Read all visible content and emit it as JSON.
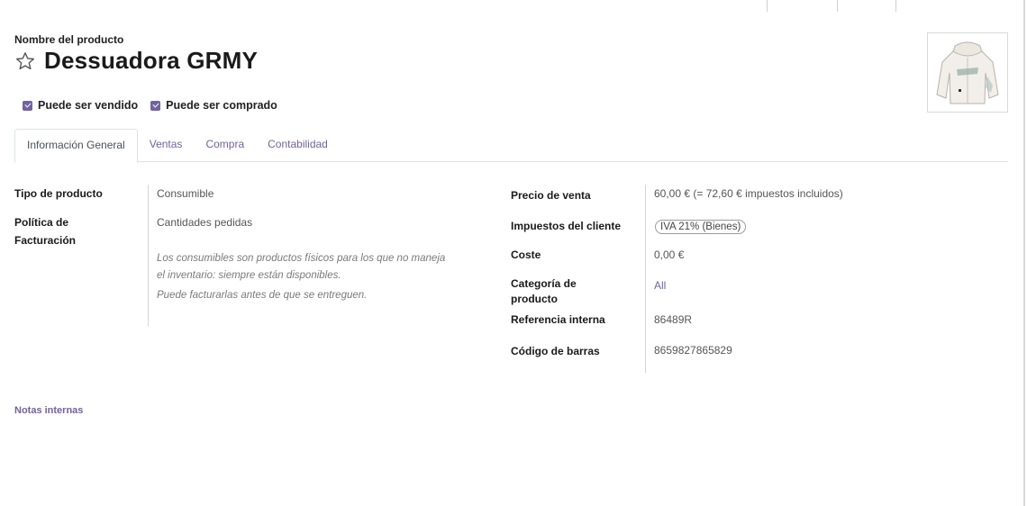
{
  "product": {
    "name_label": "Nombre del producto",
    "name": "Dessuadora GRMY"
  },
  "options": {
    "can_be_sold": "Puede ser vendido",
    "can_be_purchased": "Puede ser comprado"
  },
  "tabs": [
    {
      "label": "Información General",
      "active": true
    },
    {
      "label": "Ventas",
      "active": false
    },
    {
      "label": "Compra",
      "active": false
    },
    {
      "label": "Contabilidad",
      "active": false
    }
  ],
  "general": {
    "product_type_label": "Tipo de producto",
    "product_type_value": "Consumible",
    "invoice_policy_label": "Política de Facturación",
    "invoice_policy_value": "Cantidades pedidas",
    "help_line1": "Los consumibles son productos físicos para los que no maneja el inventario: siempre están disponibles.",
    "help_line2": "Puede facturarlas antes de que se entreguen.",
    "sale_price_label": "Precio de venta",
    "sale_price_value": "60,00 €  (= 72,60 € impuestos incluidos)",
    "customer_taxes_label": "Impuestos del cliente",
    "customer_taxes_value": "IVA 21% (Bienes)",
    "cost_label": "Coste",
    "cost_value": "0,00 €",
    "category_label": "Categoría de producto",
    "category_value": "All",
    "internal_ref_label": "Referencia interna",
    "internal_ref_value": "86489R",
    "barcode_label": "Código de barras",
    "barcode_value": "8659827865829"
  },
  "notes_link": "Notas internas",
  "icons": {
    "star": "star-outline-icon",
    "product_image": "hoodie-image"
  },
  "colors": {
    "accent": "#71639e"
  }
}
